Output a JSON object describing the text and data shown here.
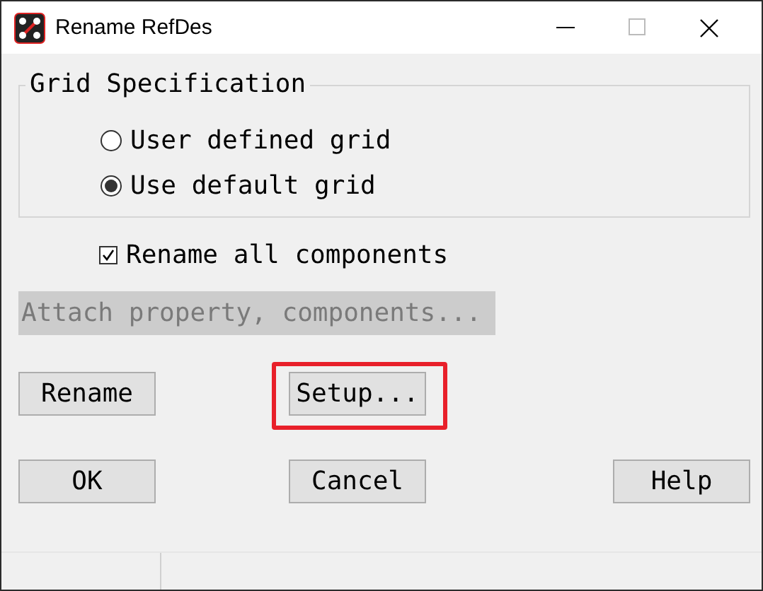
{
  "window": {
    "title": "Rename RefDes"
  },
  "grid_specification": {
    "title": "Grid Specification",
    "options": [
      {
        "label": "User defined grid",
        "selected": false
      },
      {
        "label": "Use default grid",
        "selected": true
      }
    ]
  },
  "rename_all": {
    "label": "Rename all components",
    "checked": true
  },
  "attach_button": {
    "label": "Attach property, components...",
    "disabled": true
  },
  "action_buttons": [
    {
      "label": "Rename",
      "highlighted": false
    },
    {
      "label": "Setup...",
      "highlighted": true
    }
  ],
  "buttons": [
    "OK",
    "Cancel",
    "Help"
  ]
}
